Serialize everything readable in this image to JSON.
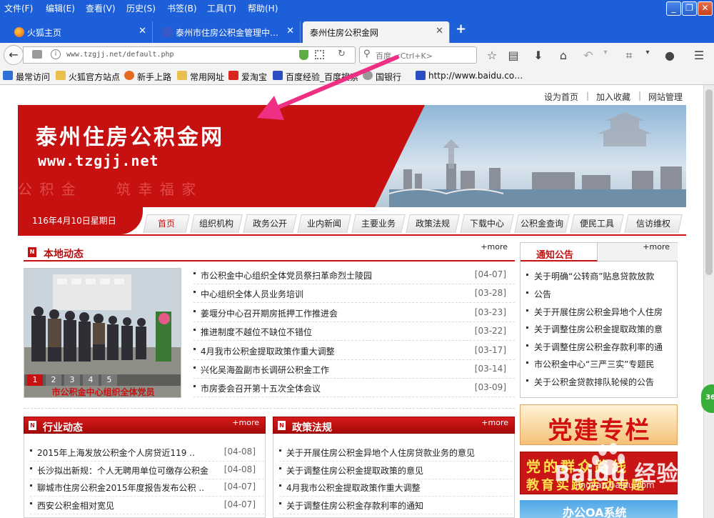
{
  "menubar": {
    "items": [
      "文件(F)",
      "编辑(E)",
      "查看(V)",
      "历史(S)",
      "书签(B)",
      "工具(T)",
      "帮助(H)"
    ]
  },
  "tabs": [
    {
      "label": "火狐主页",
      "icon": "firefox-icon"
    },
    {
      "label": "泰州市住房公积金管理中…",
      "icon": "site-icon"
    },
    {
      "label": "泰州住房公积金网",
      "icon": "none"
    }
  ],
  "navbar": {
    "url": "www.tzgjj.net/default.php",
    "search_placeholder": "百度 <Ctrl+K>"
  },
  "bookmarks": [
    {
      "label": "最常访问",
      "color": "#2f6fd6"
    },
    {
      "label": "火狐官方站点",
      "color": "#e9c04d"
    },
    {
      "label": "新手上路",
      "color": "#e56a1f"
    },
    {
      "label": "常用网址",
      "color": "#e9c04d"
    },
    {
      "label": "爱淘宝",
      "color": "#d8261d"
    },
    {
      "label": "百度经验_百度搜索",
      "color": "#2b4ec2"
    },
    {
      "label": "国银行",
      "color": "#999999"
    },
    {
      "label": "http://www.baidu.co…",
      "color": "#2b4ec2"
    }
  ],
  "site": {
    "top_links": [
      "设为首页",
      "|",
      "加入收藏",
      "|",
      "网站管理"
    ],
    "banner_title": "泰州住房公积金网",
    "banner_url": "www.tzgjj.net",
    "banner_slogan_1": "公 积 金",
    "banner_slogan_2": "筑 幸 福 家",
    "date": "116年4月10日星期日",
    "nav": [
      "首页",
      "组织机构",
      "政务公开",
      "业内新闻",
      "主要业务",
      "政策法规",
      "下载中心",
      "公积金查询",
      "便民工具",
      "信访维权"
    ],
    "local_news": {
      "title": "本地动态",
      "more": "+more",
      "photo_caption": "市公积金中心组织全体党员",
      "photo_pages": [
        "1",
        "2",
        "3",
        "4",
        "5"
      ],
      "items": [
        {
          "text": "市公积金中心组织全体党员祭扫革命烈士陵园",
          "date": "[04-07]"
        },
        {
          "text": "中心组织全体人员业务培训",
          "date": "[03-28]"
        },
        {
          "text": "姜堰分中心召开期房抵押工作推进会",
          "date": "[03-23]"
        },
        {
          "text": "推进制度不越位不缺位不错位",
          "date": "[03-22]"
        },
        {
          "text": "4月我市公积金提取政策作重大调整",
          "date": "[03-17]"
        },
        {
          "text": "兴化吴海盈副市长调研公积金工作",
          "date": "[03-14]"
        },
        {
          "text": "市房委会召开第十五次全体会议",
          "date": "[03-09]"
        }
      ]
    },
    "notice": {
      "title": "通知公告",
      "more": "+more",
      "items": [
        "关于明确“公转商”贴息贷款放款",
        "公告",
        "关于开展住房公积金异地个人住房",
        "关于调整住房公积金提取政策的意",
        "关于调整住房公积金存款利率的通",
        "市公积金中心“三严三实”专题民",
        "关于公积金贷款排队轮候的公告"
      ]
    },
    "industry": {
      "title": "行业动态",
      "more": "+more",
      "items": [
        {
          "text": "2015年上海发放公积金个人房贷近119 ..",
          "date": "[04-08]"
        },
        {
          "text": "长沙拟出新规：个人无聘用单位可缴存公积金",
          "date": "[04-08]"
        },
        {
          "text": "聊城市住房公积金2015年度报告发布公积 ..",
          "date": "[04-07]"
        },
        {
          "text": "西安公积金相对宽见",
          "date": "[04-07]"
        }
      ]
    },
    "policy": {
      "title": "政策法规",
      "more": "+more",
      "items": [
        "关于开展住房公积金异地个人住房贷款业务的意见",
        "关于调整住房公积金提取政策的意见",
        "4月我市公积金提取政策作重大调整",
        "关于调整住房公积金存款利率的通知"
      ]
    },
    "ads": {
      "party": "党建专栏",
      "mass_line": "党的群众路线",
      "mass_line_2": "教育实践活动专题",
      "oa": "办公OA系统"
    },
    "side_badge": "36",
    "watermark": "Baidu 经验",
    "watermark_url": "jingyan.baidu.com"
  },
  "colors": {
    "brand_red": "#c71111",
    "titlebar_blue": "#1c5fd8"
  }
}
